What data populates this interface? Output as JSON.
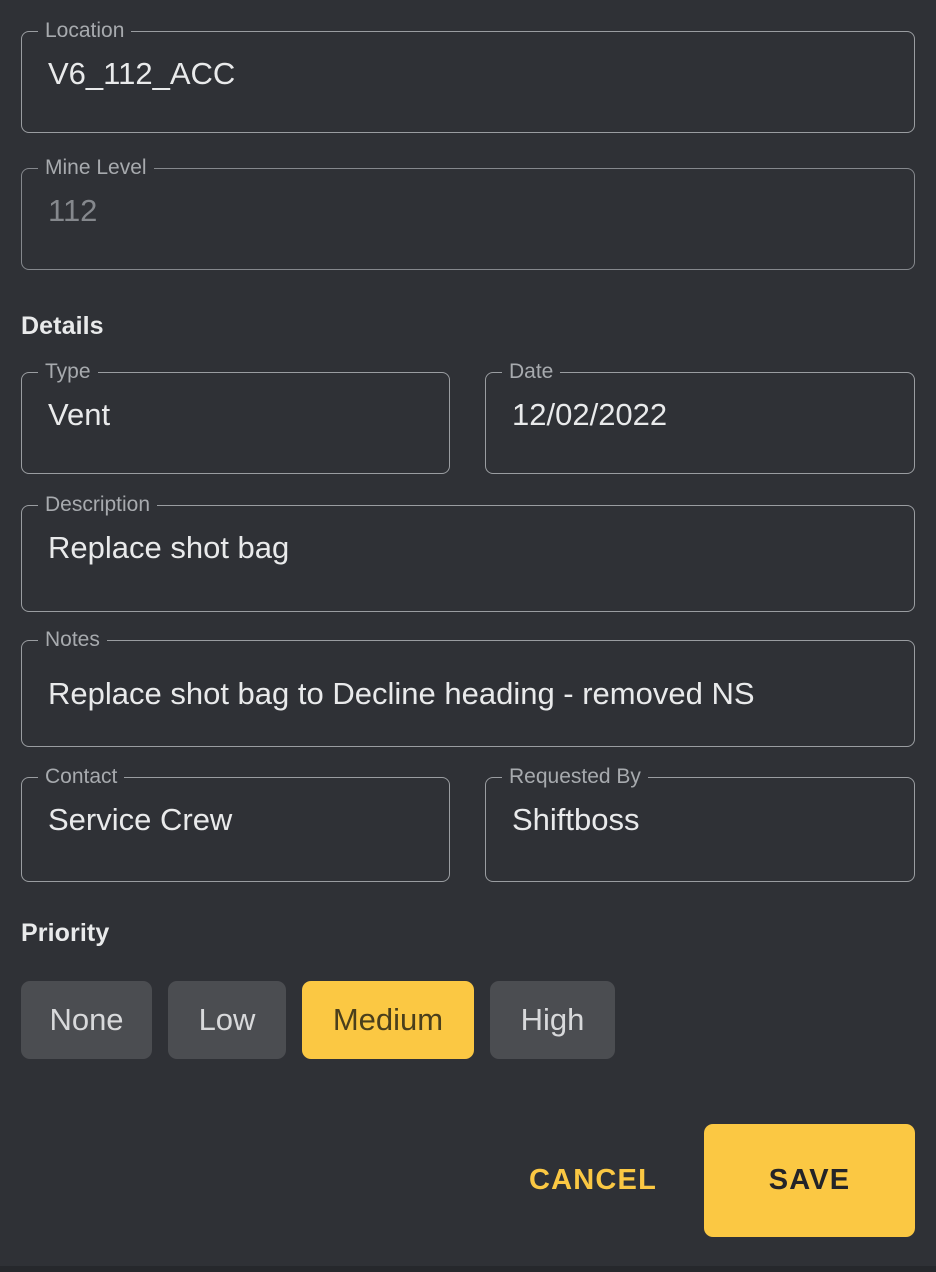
{
  "form": {
    "fields": [
      {
        "id": "location",
        "label": "Location",
        "value": "V6_112_ACC",
        "is_placeholder": false
      },
      {
        "id": "mine_level",
        "label": "Mine Level",
        "value": "112",
        "is_placeholder": true
      },
      {
        "id": "type",
        "label": "Type",
        "value": "Vent",
        "is_placeholder": false
      },
      {
        "id": "date",
        "label": "Date",
        "value": "12/02/2022",
        "is_placeholder": false
      },
      {
        "id": "description",
        "label": "Description",
        "value": "Replace shot bag",
        "is_placeholder": false
      },
      {
        "id": "notes",
        "label": "Notes",
        "value": "Replace shot bag to Decline heading - removed NS",
        "is_placeholder": false
      },
      {
        "id": "contact",
        "label": "Contact",
        "value": "Service Crew",
        "is_placeholder": false
      },
      {
        "id": "requested_by",
        "label": "Requested By",
        "value": "Shiftboss",
        "is_placeholder": false
      }
    ],
    "sections": {
      "details_title": "Details",
      "priority_title": "Priority"
    },
    "priority": {
      "options": [
        {
          "label": "None",
          "selected": false
        },
        {
          "label": "Low",
          "selected": false
        },
        {
          "label": "Medium",
          "selected": true
        },
        {
          "label": "High",
          "selected": false
        }
      ],
      "selected_value": "Medium"
    },
    "actions": {
      "cancel_label": "CANCEL",
      "save_label": "SAVE"
    }
  },
  "colors": {
    "background": "#2f3136",
    "accent": "#fbc843",
    "accent_text_on_fill": "#232428",
    "field_outline": "#9a9da1",
    "field_outline_dim": "#85888d",
    "text_primary": "#e9eaeb",
    "text_secondary": "#a7aaae",
    "text_placeholder": "#85888d",
    "chip_unselected": "#4b4d51",
    "chip_selected_text": "#4a3f1c"
  }
}
